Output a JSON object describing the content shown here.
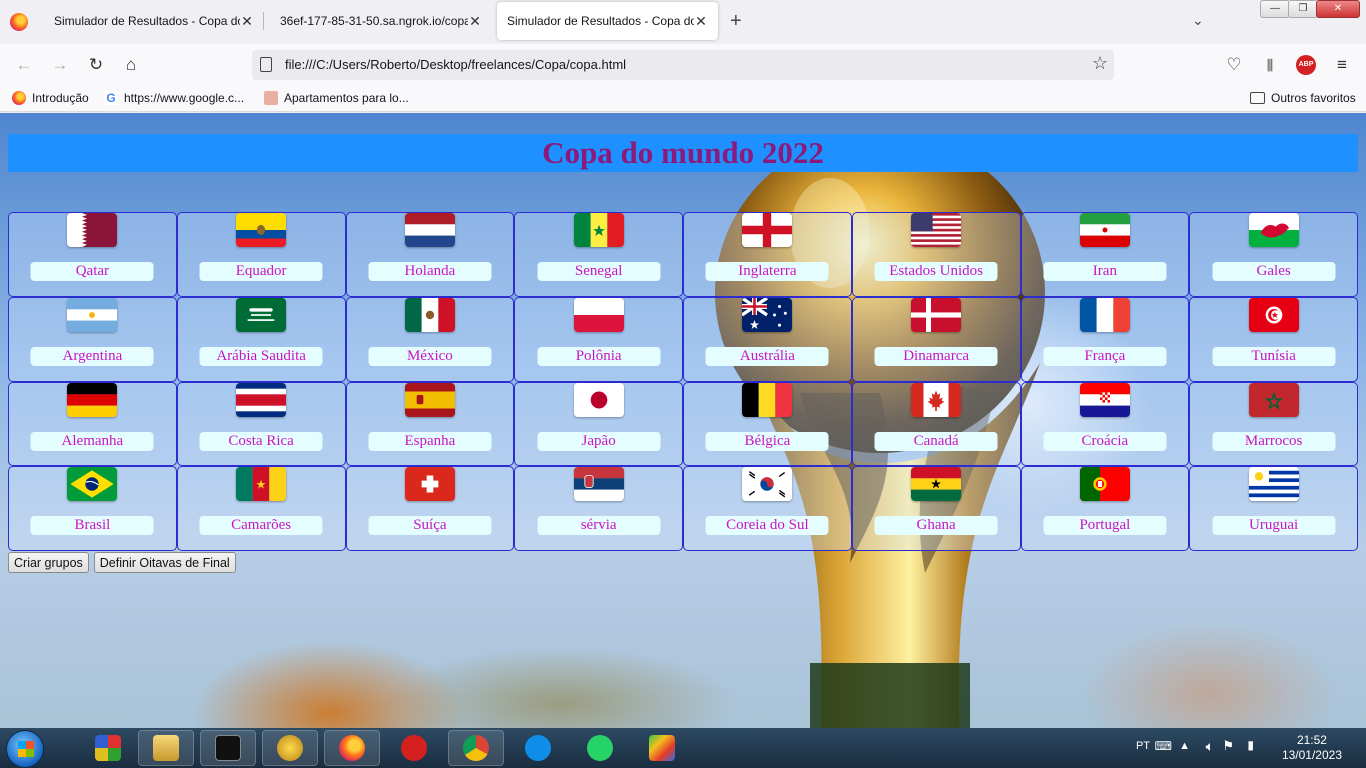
{
  "browser": {
    "tabs": [
      {
        "label": "Simulador de Resultados - Copa do",
        "active": false
      },
      {
        "label": "36ef-177-85-31-50.sa.ngrok.io/copa",
        "active": false
      },
      {
        "label": "Simulador de Resultados - Copa do",
        "active": true
      }
    ],
    "url": "file:///C:/Users/Roberto/Desktop/freelances/Copa/copa.html",
    "bookmarks": [
      "Introdução",
      "https://www.google.c...",
      "Apartamentos para lo..."
    ],
    "other_bookmarks": "Outros favoritos",
    "abp_label": "ABP"
  },
  "page": {
    "title": "Copa do mundo 2022",
    "teams": [
      {
        "name": "Qatar",
        "flag": "qatar-flag"
      },
      {
        "name": "Equador",
        "flag": "ecuador-flag"
      },
      {
        "name": "Holanda",
        "flag": "netherlands-flag"
      },
      {
        "name": "Senegal",
        "flag": "senegal-flag"
      },
      {
        "name": "Inglaterra",
        "flag": "england-flag"
      },
      {
        "name": "Estados Unidos",
        "flag": "usa-flag"
      },
      {
        "name": "Iran",
        "flag": "iran-flag"
      },
      {
        "name": "Gales",
        "flag": "wales-flag"
      },
      {
        "name": "Argentina",
        "flag": "argentina-flag"
      },
      {
        "name": "Arábia Saudita",
        "flag": "saudi-arabia-flag"
      },
      {
        "name": "México",
        "flag": "mexico-flag"
      },
      {
        "name": "Polônia",
        "flag": "poland-flag"
      },
      {
        "name": "Austrália",
        "flag": "australia-flag"
      },
      {
        "name": "Dinamarca",
        "flag": "denmark-flag"
      },
      {
        "name": "França",
        "flag": "france-flag"
      },
      {
        "name": "Tunísia",
        "flag": "tunisia-flag"
      },
      {
        "name": "Alemanha",
        "flag": "germany-flag"
      },
      {
        "name": "Costa Rica",
        "flag": "costa-rica-flag"
      },
      {
        "name": "Espanha",
        "flag": "spain-flag"
      },
      {
        "name": "Japão",
        "flag": "japan-flag"
      },
      {
        "name": "Bélgica",
        "flag": "belgium-flag"
      },
      {
        "name": "Canadá",
        "flag": "canada-flag"
      },
      {
        "name": "Croácia",
        "flag": "croatia-flag"
      },
      {
        "name": "Marrocos",
        "flag": "morocco-flag"
      },
      {
        "name": "Brasil",
        "flag": "brazil-flag"
      },
      {
        "name": "Camarões",
        "flag": "cameroon-flag"
      },
      {
        "name": "Suíça",
        "flag": "switzerland-flag"
      },
      {
        "name": "sérvia",
        "flag": "serbia-flag"
      },
      {
        "name": "Coreia do Sul",
        "flag": "south-korea-flag"
      },
      {
        "name": "Ghana",
        "flag": "ghana-flag"
      },
      {
        "name": "Portugal",
        "flag": "portugal-flag"
      },
      {
        "name": "Uruguai",
        "flag": "uruguay-flag"
      }
    ],
    "buttons": {
      "create_groups": "Criar grupos",
      "round_of_16": "Definir Oitavas de Final"
    }
  },
  "taskbar": {
    "language": "PT",
    "time": "21:52",
    "date": "13/01/2023",
    "apps": [
      "windows-flag-icon",
      "file-explorer-icon",
      "terminal-icon",
      "teapot-icon",
      "firefox-icon",
      "pokerstars-icon",
      "chrome-icon",
      "teamviewer-icon",
      "whatsapp-icon",
      "bluestacks-icon"
    ]
  },
  "colors": {
    "title_bar": "#1e90ff",
    "title_text": "#8b1a7a",
    "team_text": "#cc15c0",
    "team_label_bg": "#e4fdff",
    "cell_border": "#2c2cd0"
  }
}
